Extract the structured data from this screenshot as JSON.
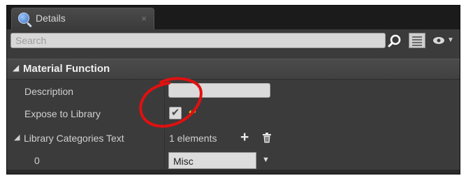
{
  "panel": {
    "tab_title": "Details",
    "tab_close": "×",
    "search_placeholder": "Search"
  },
  "section": {
    "title": "Material Function",
    "arrow": "◢"
  },
  "properties": {
    "description_label": "Description",
    "description_value": "",
    "expose_label": "Expose to Library",
    "expose_checked": true,
    "expose_check_glyph": "✔",
    "reset_glyph": "↩",
    "library_label": "Library Categories Text",
    "library_count_text": "1 elements",
    "plus_glyph": "+",
    "item_index": "0",
    "item_value": "Misc",
    "dropdown_caret": "▼"
  },
  "icons": {
    "tab_icon": "details-magnifier-icon",
    "search": "search-icon",
    "view_options": "grid-view-icon",
    "visibility": "eye-icon",
    "add": "plus-icon",
    "remove": "trash-icon",
    "reset": "reset-to-default-icon"
  },
  "colors": {
    "panel_bg": "#3b3b3b",
    "header_bg": "#464646",
    "input_bg": "#dadada",
    "annotation_red": "#e01010",
    "reset_yellow": "#f0c020"
  }
}
